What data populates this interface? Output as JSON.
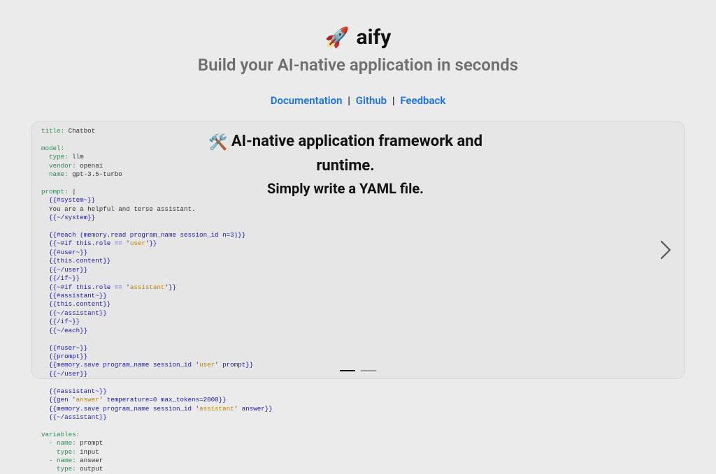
{
  "header": {
    "rocket_icon": "🚀",
    "title": "aify",
    "subtitle": "Build your AI-native application in seconds"
  },
  "links": {
    "documentation": "Documentation",
    "github": "Github",
    "feedback": "Feedback",
    "separator": " | "
  },
  "card": {
    "hammer_icon": "🛠️",
    "headline_line1": "AI-native application framework and",
    "headline_line2": "runtime.",
    "subline": "Simply write a YAML file."
  },
  "yaml": {
    "title_key": "title:",
    "title_val": " Chatbot",
    "model_key": "model:",
    "type_key": "  type:",
    "type_val": " llm",
    "vendor_key": "  vendor:",
    "vendor_val": " openai",
    "name_key": "  name:",
    "name_val": " gpt-3.5-turbo",
    "prompt_key": "prompt:",
    "prompt_pipe": " |",
    "sys_open": "  {{#system~}}",
    "sys_text": "  You are a helpful and terse assistant.",
    "sys_close": "  {{~/system}}",
    "each_open1": "  {{#each (memory.read program_name session_id n=3)}}",
    "if_user_a": "  {{~#if this.role == '",
    "if_user_b": "user",
    "if_user_c": "'}}",
    "user_open": "  {{#user~}}",
    "this_content": "  {{this.content}}",
    "user_close": "  {{~/user}}",
    "endif1": "  {{/if~}}",
    "if_asst_a": "  {{~#if this.role == '",
    "if_asst_b": "assistant",
    "if_asst_c": "'}}",
    "asst_open": "  {{#assistant~}}",
    "this_content2": "  {{this.content}}",
    "asst_close": "  {{~/assistant}}",
    "endif2": "  {{/if~}}",
    "each_close": "  {{~/each}}",
    "user_open2": "  {{#user~}}",
    "prompt_ref": "  {{prompt}}",
    "save_user_a": "  {{memory.save program_name session_id '",
    "save_user_b": "user",
    "save_user_c": "' prompt}}",
    "user_close2": "  {{~/user}}",
    "asst_open2": "  {{#assistant~}}",
    "gen_a": "  {{gen '",
    "gen_b": "answer",
    "gen_c": "' temperature=0 max_tokens=2000}}",
    "save_asst_a": "  {{memory.save program_name session_id '",
    "save_asst_b": "assistant",
    "save_asst_c": "' answer}}",
    "asst_close2": "  {{~/assistant}}",
    "vars_key": "variables:",
    "v1_name_key": "  - name:",
    "v1_name_val": " prompt",
    "v1_type_key": "    type:",
    "v1_type_val": " input",
    "v2_name_key": "  - name:",
    "v2_name_val": " answer",
    "v2_type_key": "    type:",
    "v2_type_val": " output"
  }
}
